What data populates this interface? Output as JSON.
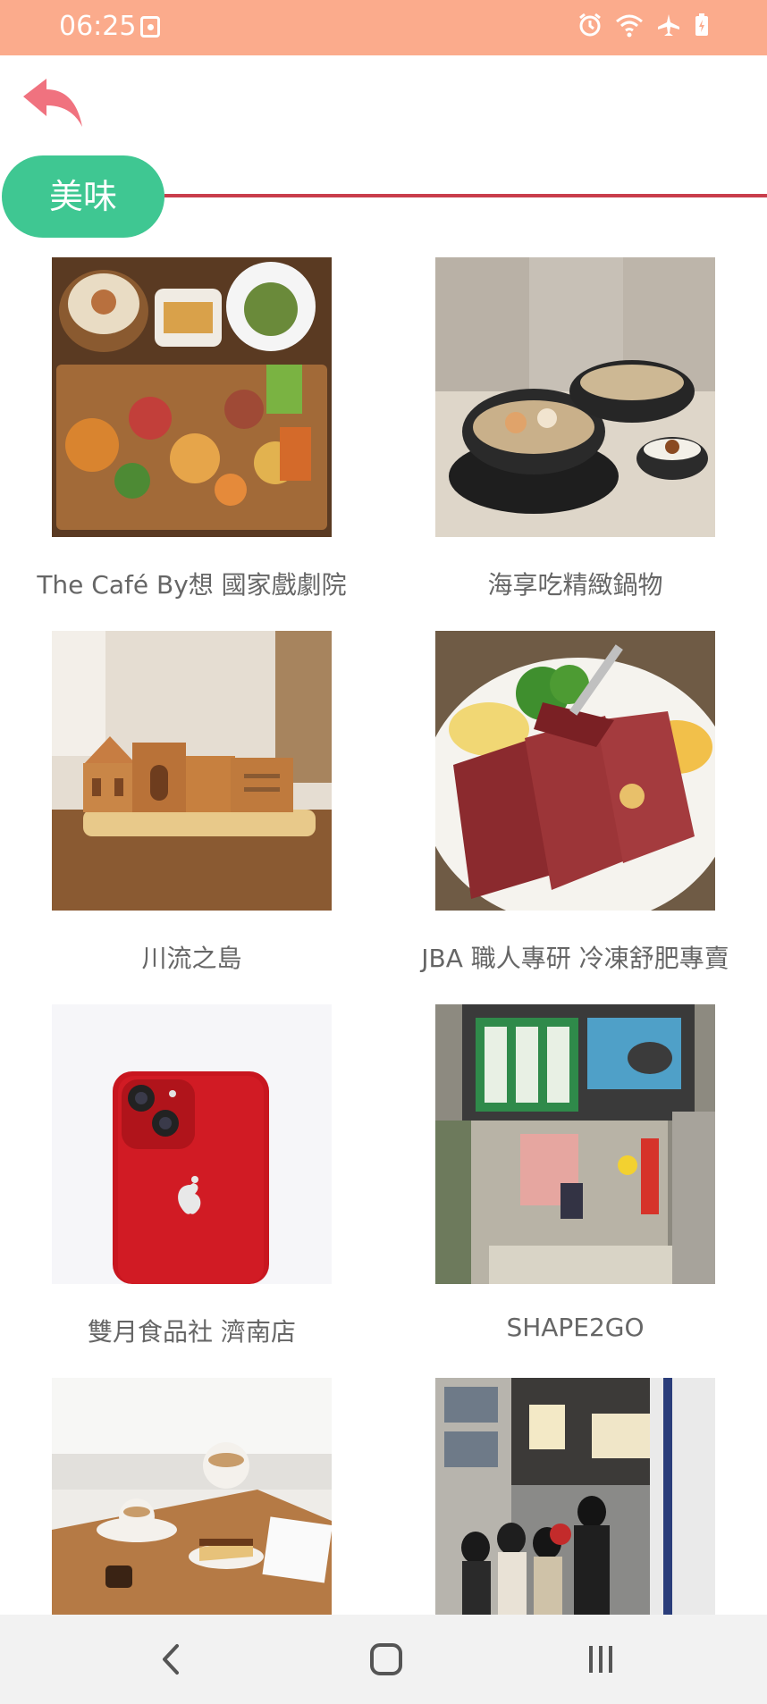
{
  "status_bar": {
    "time": "06:25",
    "icons": [
      "alarm-icon",
      "wifi-icon",
      "airplane-mode-icon",
      "battery-charging-icon"
    ]
  },
  "header": {
    "back_icon": "undo-arrow-icon",
    "category": "美味"
  },
  "items": [
    {
      "name": "The Café By想 國家戲劇院",
      "image": "platter-photo"
    },
    {
      "name": "海享吃精緻鍋物",
      "image": "hotpot-photo"
    },
    {
      "name": "川流之島",
      "image": "cake-house-photo"
    },
    {
      "name": "JBA 職人專研 冷凍舒肥專賣",
      "image": "steak-photo"
    },
    {
      "name": "雙月食品社 濟南店",
      "image": "red-phone-photo"
    },
    {
      "name": "SHAPE2GO",
      "image": "storefront-photo"
    },
    {
      "name": "",
      "image": "coffee-cake-photo"
    },
    {
      "name": "",
      "image": "street-stall-photo"
    }
  ],
  "nav_bar": {
    "icons": [
      "back-nav-icon",
      "home-nav-icon",
      "recents-nav-icon"
    ]
  },
  "colors": {
    "status_bar": "#fbab8c",
    "accent_green": "#3fc792",
    "divider_red": "#c93d4c",
    "back_arrow": "#f0727f"
  }
}
